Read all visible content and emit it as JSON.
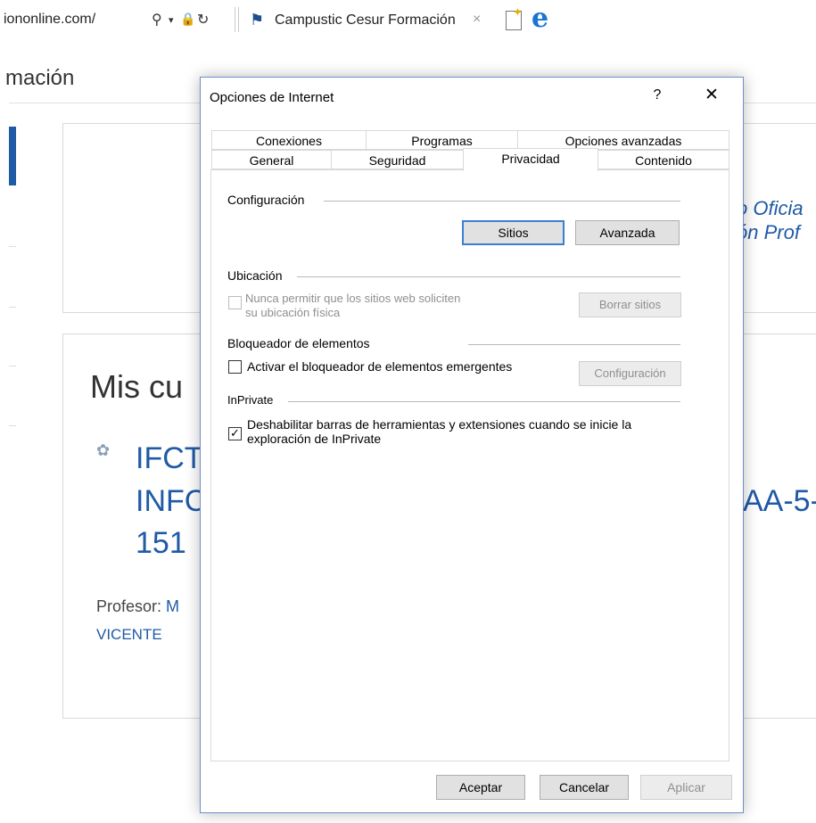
{
  "browser": {
    "url_fragment": "iononline.com/",
    "tab_title": "Campustic Cesur Formación",
    "search_icon": "search-icon",
    "dropdown_icon": "chevron-down-icon",
    "lock_icon": "lock-icon",
    "refresh_icon": "refresh-icon",
    "close_glyph": "×"
  },
  "page": {
    "heading": "mación",
    "header_right_1": "o Oficia",
    "header_right_2": "ón Prof",
    "courses_title": "Mis cu",
    "course_line1": "IFCT",
    "course_line2": "INFC",
    "course_line3": "151",
    "course_right": "AA-5-",
    "teacher_label": "Profesor: ",
    "teacher_name_part1": "M",
    "teacher_name_part2": "VICENTE"
  },
  "dialog": {
    "title": "Opciones de Internet",
    "help_glyph": "?",
    "close_glyph": "✕",
    "tabs_row1": [
      "Conexiones",
      "Programas",
      "Opciones avanzadas"
    ],
    "tabs_row2": [
      "General",
      "Seguridad",
      "Privacidad",
      "Contenido"
    ],
    "active_tab": "Privacidad",
    "configuracion": {
      "label": "Configuración",
      "sites_button": "Sitios",
      "advanced_button": "Avanzada"
    },
    "ubicacion": {
      "label": "Ubicación",
      "checkbox_line1": "Nunca permitir que los sitios web soliciten",
      "checkbox_line2": "su ubicación física",
      "checked": false,
      "enabled": false,
      "clear_button": "Borrar sitios"
    },
    "bloqueador": {
      "label": "Bloqueador de elementos",
      "checkbox_text": "Activar el bloqueador de elementos emergentes",
      "checked": false,
      "config_button": "Configuración"
    },
    "inprivate": {
      "label": "InPrivate",
      "checkbox_line1": "Deshabilitar barras de herramientas y extensiones cuando se inicie la",
      "checkbox_line2": "exploración de InPrivate",
      "checked": true
    },
    "footer": {
      "accept_button": "Aceptar",
      "cancel_button": "Cancelar",
      "apply_button": "Aplicar"
    }
  },
  "colors": {
    "accent_blue": "#1f5aa6",
    "dialog_border": "#6d8fc8",
    "default_button_border": "#3c7fd4"
  }
}
